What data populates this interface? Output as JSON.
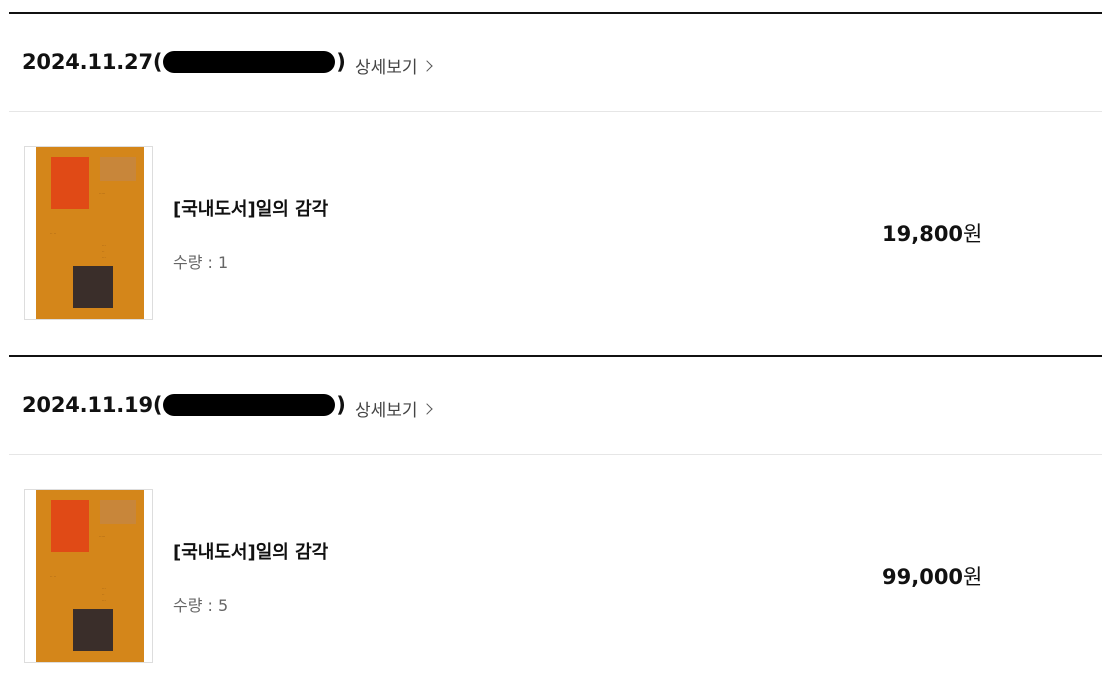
{
  "orders": [
    {
      "date": "2024.11.27",
      "paren_open": "(",
      "paren_close": ")",
      "detail_label": "상세보기",
      "item": {
        "title": "[국내도서]일의 감각",
        "quantity": "수량 : 1",
        "price": "19,800",
        "currency": "원"
      }
    },
    {
      "date": "2024.11.19",
      "paren_open": "(",
      "paren_close": ")",
      "detail_label": "상세보기",
      "item": {
        "title": "[국내도서]일의 감각",
        "quantity": "수량 : 5",
        "price": "99,000",
        "currency": "원"
      }
    }
  ],
  "colors": {
    "cover_orange": "#d4861a",
    "cover_red": "#e04a16",
    "cover_brown": "#3a2e2a",
    "rule_dark": "#111111",
    "rule_light": "#e6e6e6"
  },
  "icons": {
    "detail": "chevron-right-icon"
  }
}
